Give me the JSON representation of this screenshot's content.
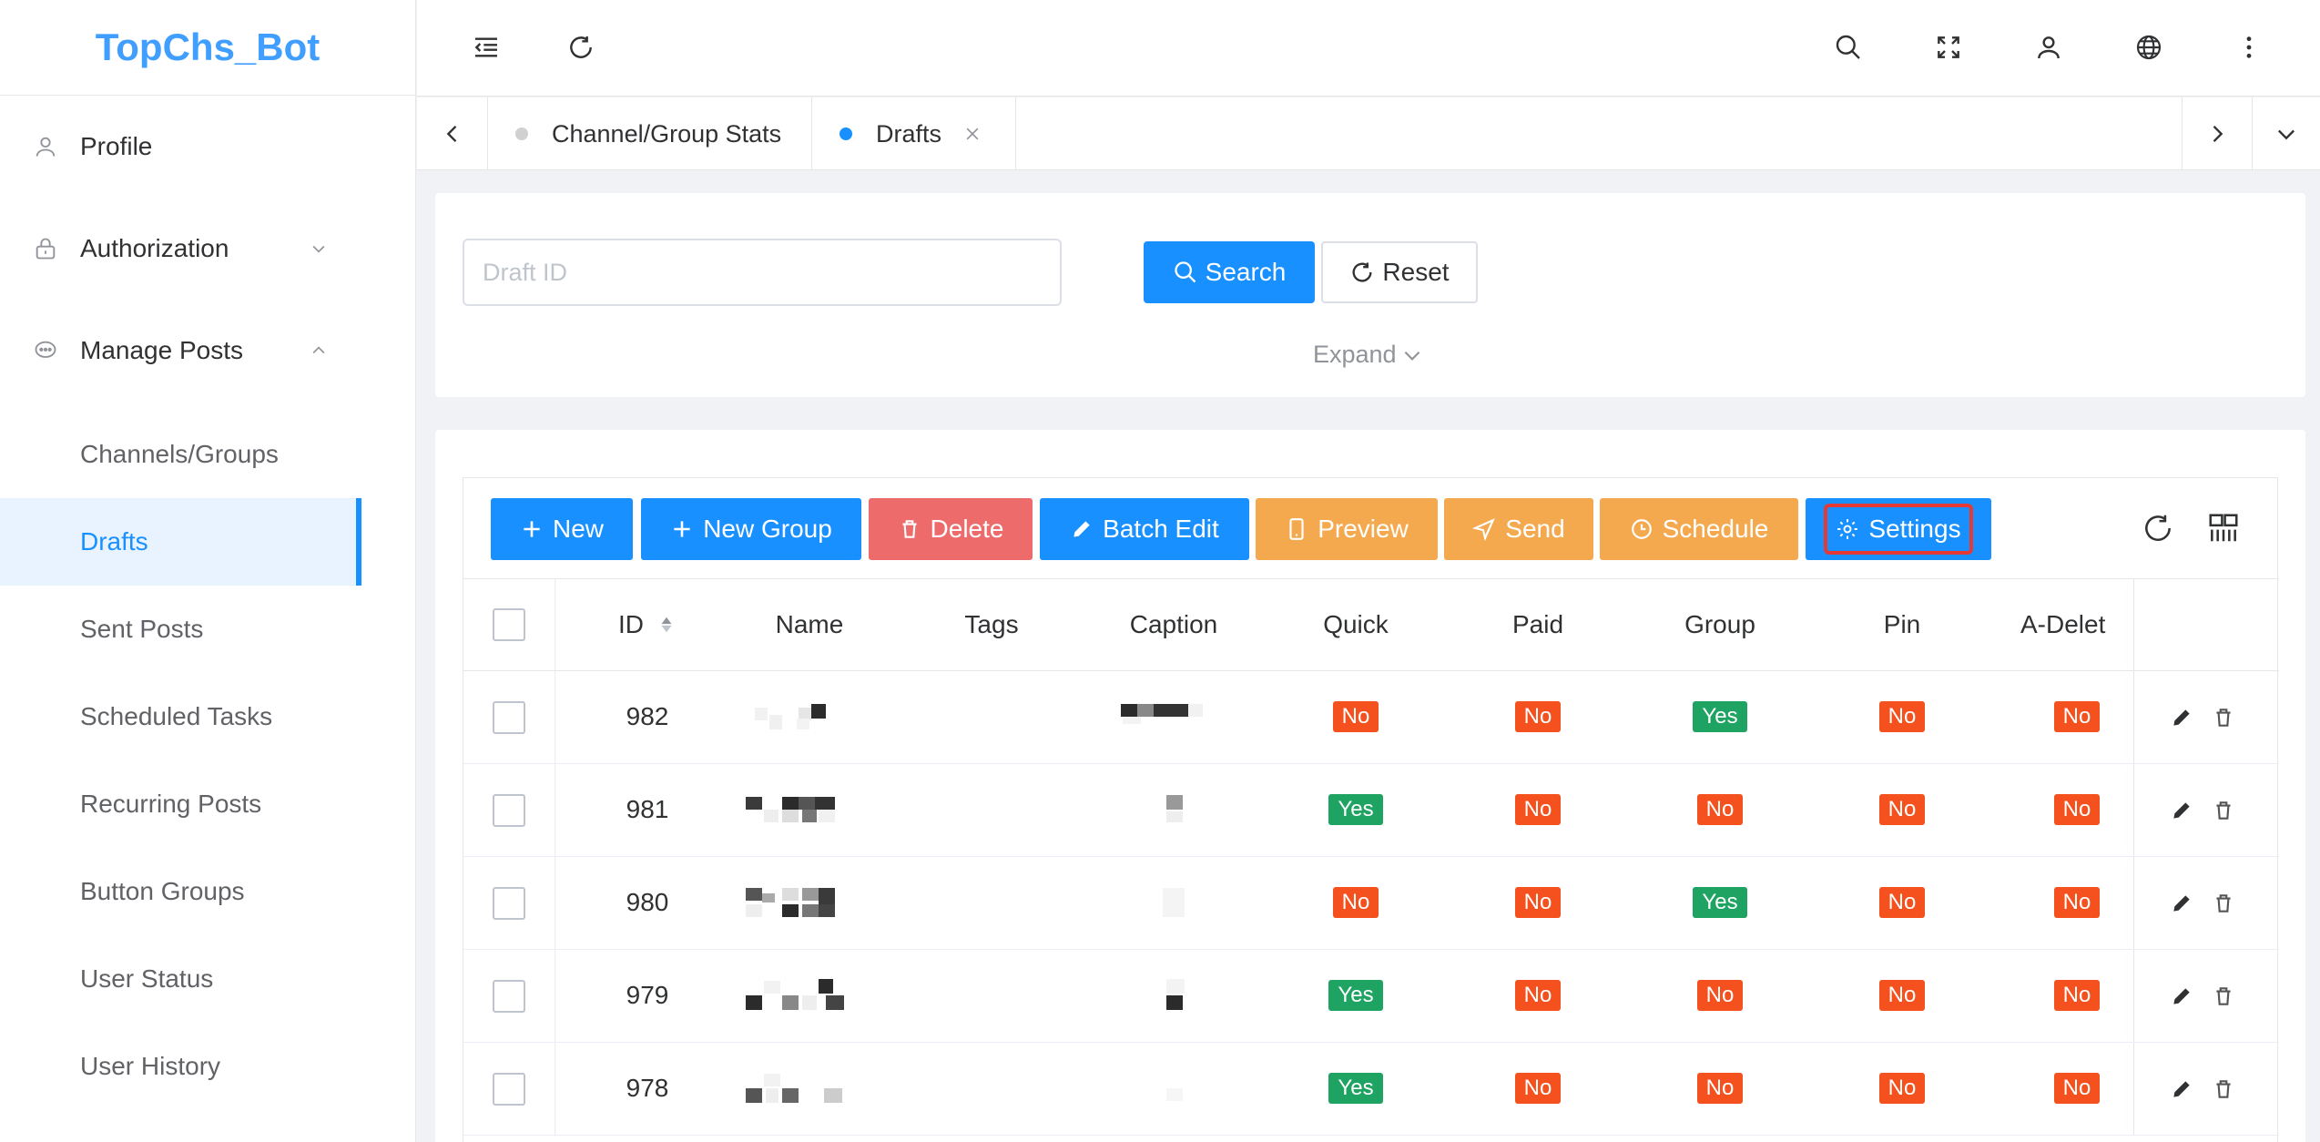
{
  "app": {
    "title": "TopChs_Bot"
  },
  "sidebar": {
    "profile": "Profile",
    "authorization": "Authorization",
    "manage_posts": "Manage Posts",
    "items": [
      "Channels/Groups",
      "Drafts",
      "Sent Posts",
      "Scheduled Tasks",
      "Recurring Posts",
      "Button Groups",
      "User Status",
      "User History"
    ]
  },
  "tabs": {
    "stats": "Channel/Group Stats",
    "drafts": "Drafts"
  },
  "search": {
    "placeholder": "Draft ID",
    "value": "",
    "search_label": "Search",
    "reset_label": "Reset",
    "expand_label": "Expand"
  },
  "toolbar": {
    "new": "New",
    "new_group": "New Group",
    "delete": "Delete",
    "batch_edit": "Batch Edit",
    "preview": "Preview",
    "send": "Send",
    "schedule": "Schedule",
    "settings": "Settings"
  },
  "table": {
    "columns": [
      "ID",
      "Name",
      "Tags",
      "Caption",
      "Quick",
      "Paid",
      "Group",
      "Pin",
      "A-Delet"
    ],
    "rows": [
      {
        "id": "982",
        "quick": "No",
        "paid": "No",
        "group": "Yes",
        "pin": "No",
        "adelete": "No"
      },
      {
        "id": "981",
        "quick": "Yes",
        "paid": "No",
        "group": "No",
        "pin": "No",
        "adelete": "No"
      },
      {
        "id": "980",
        "quick": "No",
        "paid": "No",
        "group": "Yes",
        "pin": "No",
        "adelete": "No"
      },
      {
        "id": "979",
        "quick": "Yes",
        "paid": "No",
        "group": "No",
        "pin": "No",
        "adelete": "No"
      },
      {
        "id": "978",
        "quick": "Yes",
        "paid": "No",
        "group": "No",
        "pin": "No",
        "adelete": "No"
      }
    ]
  },
  "colors": {
    "primary": "#1890ff",
    "danger": "#ee6b6b",
    "warning": "#f5a94e",
    "tag_no": "#f4511e",
    "tag_yes": "#1ea362",
    "highlight": "#e53935"
  }
}
